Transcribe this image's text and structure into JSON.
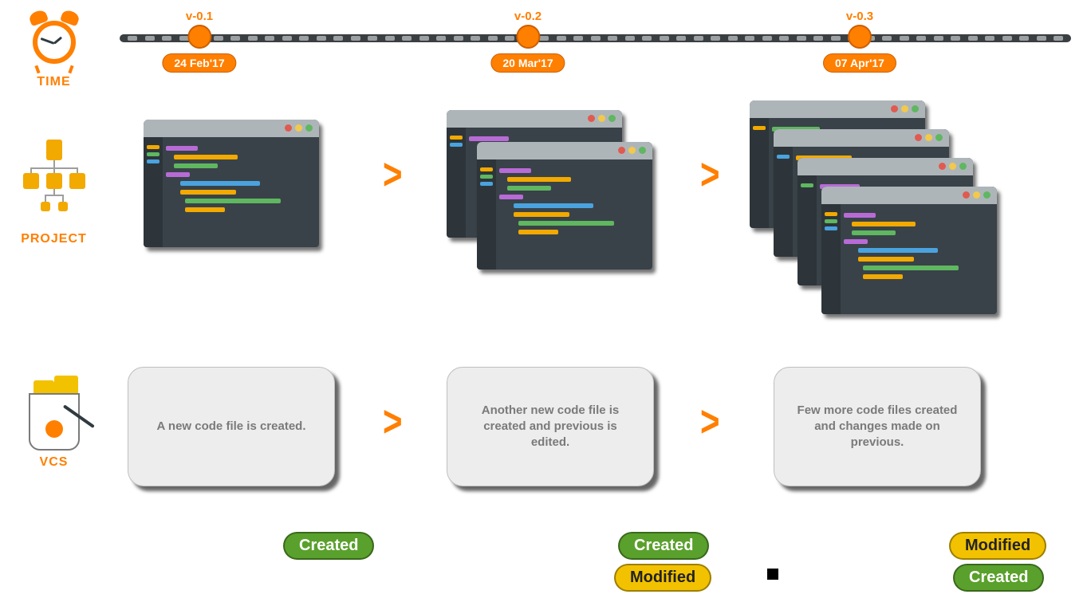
{
  "sections": {
    "time_label": "TIME",
    "project_label": "PROJECT",
    "vcs_label": "VCS"
  },
  "timeline": {
    "versions": [
      {
        "label": "v-0.1",
        "date": "24 Feb'17"
      },
      {
        "label": "v-0.2",
        "date": "20 Mar'17"
      },
      {
        "label": "v-0.3",
        "date": "07 Apr'17"
      }
    ]
  },
  "project": {
    "stage1_files": 1,
    "stage2_files": 2,
    "stage3_files": 4
  },
  "vcs": {
    "cards": [
      "A new code file is created.",
      "Another new code file is created and previous is edited.",
      "Few more code files created and changes made on previous."
    ]
  },
  "status": {
    "created": "Created",
    "modified": "Modified"
  },
  "icons": {
    "time": "alarm-clock-icon",
    "project": "org-chart-icon",
    "vcs": "fries-bucket-icon"
  }
}
